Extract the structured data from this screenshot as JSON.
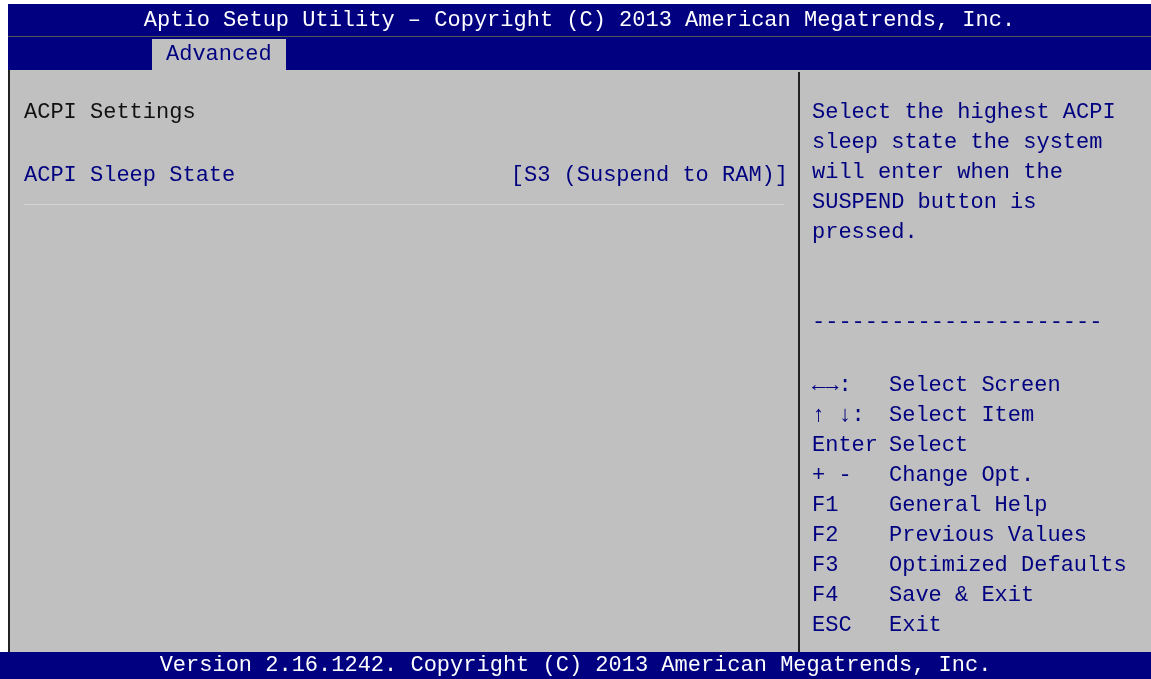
{
  "window": {
    "title": "Aptio Setup Utility – Copyright (C) 2013 American Megatrends, Inc."
  },
  "tabs": [
    {
      "label": "Advanced",
      "selected": true
    }
  ],
  "section_title": "ACPI Settings",
  "settings": [
    {
      "label": "ACPI Sleep State",
      "value": "[S3 (Suspend to RAM)]",
      "selected": false
    }
  ],
  "help": {
    "text": "Select the highest ACPI sleep state the system will enter when the SUSPEND button is pressed.",
    "divider": "----------------------"
  },
  "keys": [
    {
      "key": "←→:",
      "action": "Select Screen"
    },
    {
      "key": "↑ ↓:",
      "action": "Select Item"
    },
    {
      "key": "Enter",
      "action": "Select"
    },
    {
      "key": "+ -",
      "action": "Change Opt."
    },
    {
      "key": "F1",
      "action": "General Help"
    },
    {
      "key": "F2",
      "action": "Previous Values"
    },
    {
      "key": "F3",
      "action": "Optimized Defaults"
    },
    {
      "key": "F4",
      "action": "Save & Exit"
    },
    {
      "key": "ESC",
      "action": "Exit"
    }
  ],
  "status_bar": "Version 2.16.1242. Copyright (C) 2013 American Megatrends, Inc."
}
